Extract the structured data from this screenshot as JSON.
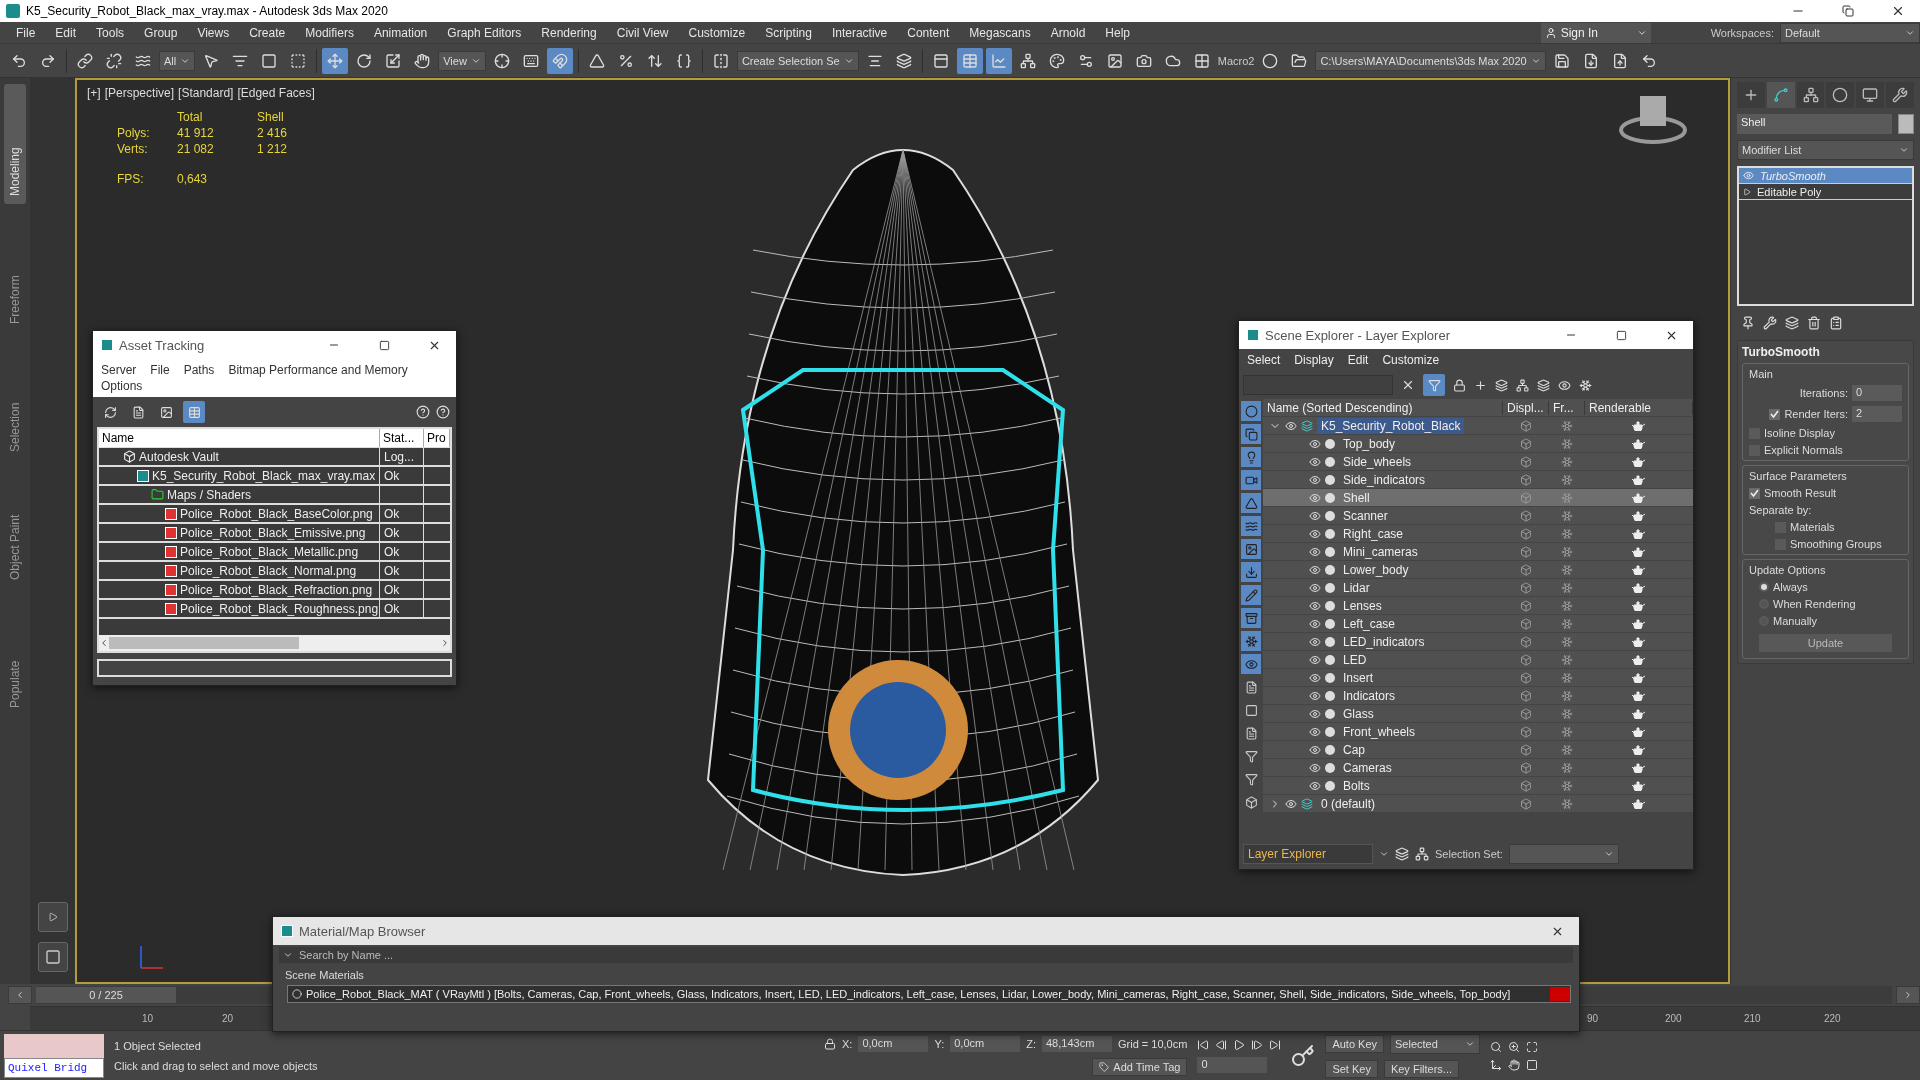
{
  "window": {
    "title": "K5_Security_Robot_Black_max_vray.max - Autodesk 3ds Max 2020"
  },
  "menu": [
    "File",
    "Edit",
    "Tools",
    "Group",
    "Views",
    "Create",
    "Modifiers",
    "Animation",
    "Graph Editors",
    "Rendering",
    "Civil View",
    "Customize",
    "Scripting",
    "Interactive",
    "Content",
    "Megascans",
    "Arnold",
    "Help"
  ],
  "account": {
    "sign_in": "Sign In",
    "workspaces_label": "Workspaces:",
    "workspace": "Default"
  },
  "toolbar": [
    {
      "kind": "icon",
      "selected": false
    },
    {
      "kind": "icon",
      "selected": false
    },
    {
      "kind": "sep"
    },
    {
      "kind": "icon",
      "selected": false
    },
    {
      "kind": "icon",
      "selected": false
    },
    {
      "kind": "icon",
      "selected": false
    },
    {
      "kind": "dropdown",
      "value": "All"
    },
    {
      "kind": "icon",
      "selected": false
    },
    {
      "kind": "icon",
      "selected": false
    },
    {
      "kind": "icon",
      "selected": false
    },
    {
      "kind": "icon",
      "selected": false
    },
    {
      "kind": "sep"
    },
    {
      "kind": "icon",
      "selected": true
    },
    {
      "kind": "icon",
      "selected": false
    },
    {
      "kind": "icon",
      "selected": false
    },
    {
      "kind": "icon",
      "selected": false
    },
    {
      "kind": "dropdown",
      "value": "View"
    },
    {
      "kind": "icon",
      "selected": false
    },
    {
      "kind": "icon",
      "selected": false
    },
    {
      "kind": "icon",
      "selected": true
    },
    {
      "kind": "sep"
    },
    {
      "kind": "icon",
      "selected": false
    },
    {
      "kind": "icon",
      "selected": false
    },
    {
      "kind": "icon",
      "selected": false
    },
    {
      "kind": "icon",
      "selected": false
    },
    {
      "kind": "sep"
    },
    {
      "kind": "icon",
      "selected": false
    },
    {
      "kind": "dropdown",
      "value": "Create Selection Se"
    },
    {
      "kind": "icon",
      "selected": false
    },
    {
      "kind": "icon",
      "selected": false
    },
    {
      "kind": "sep"
    },
    {
      "kind": "icon",
      "selected": false
    },
    {
      "kind": "icon",
      "selected": true
    },
    {
      "kind": "icon",
      "selected": true
    },
    {
      "kind": "icon",
      "selected": false
    },
    {
      "kind": "icon",
      "selected": false
    },
    {
      "kind": "icon",
      "selected": false
    },
    {
      "kind": "icon",
      "selected": false
    },
    {
      "kind": "icon",
      "selected": false
    },
    {
      "kind": "icon",
      "selected": false
    },
    {
      "kind": "icon",
      "selected": false
    },
    {
      "kind": "label",
      "value": "Macro2"
    },
    {
      "kind": "icon",
      "selected": false
    },
    {
      "kind": "icon",
      "selected": false
    },
    {
      "kind": "dropdown",
      "value": "C:\\Users\\MAYA\\Documents\\3ds Max 2020"
    },
    {
      "kind": "icon",
      "selected": false
    },
    {
      "kind": "icon",
      "selected": false
    },
    {
      "kind": "icon",
      "selected": false
    },
    {
      "kind": "icon",
      "selected": false
    }
  ],
  "ribbon_tabs": [
    {
      "label": "Modeling",
      "selected": true
    },
    {
      "label": "Freeform",
      "selected": false
    },
    {
      "label": "Selection",
      "selected": false
    },
    {
      "label": "Object Paint",
      "selected": false
    },
    {
      "label": "Populate",
      "selected": false
    }
  ],
  "viewport": {
    "labels": [
      "[+]",
      "[Perspective]",
      "[Standard]",
      "[Edged Faces]"
    ],
    "stats": {
      "header": [
        "Total",
        "Shell"
      ],
      "rows": [
        {
          "label": "Polys:",
          "total": "41 912",
          "shell": "2 416"
        },
        {
          "label": "Verts:",
          "total": "21 082",
          "shell": "1 212"
        }
      ],
      "fps_label": "FPS:",
      "fps": "0,643"
    }
  },
  "asset_tracking": {
    "title": "Asset Tracking",
    "menu": [
      "Server",
      "File",
      "Paths",
      "Bitmap Performance and Memory",
      "Options"
    ],
    "view_buttons": [
      {
        "selected": false
      },
      {
        "selected": false
      },
      {
        "selected": false
      },
      {
        "selected": true
      }
    ],
    "columns": [
      "Name",
      "Stat...",
      "Pro"
    ],
    "rows": [
      {
        "kind": "vault",
        "name": "Autodesk Vault",
        "status": "Log...",
        "children": [
          {
            "kind": "scene",
            "name": "K5_Security_Robot_Black_max_vray.max",
            "status": "Ok",
            "children": [
              {
                "kind": "folder",
                "name": "Maps / Shaders",
                "children": [
                  {
                    "kind": "bitmap",
                    "name": "Police_Robot_Black_BaseColor.png",
                    "status": "Ok"
                  },
                  {
                    "kind": "bitmap",
                    "name": "Police_Robot_Black_Emissive.png",
                    "status": "Ok"
                  },
                  {
                    "kind": "bitmap",
                    "name": "Police_Robot_Black_Metallic.png",
                    "status": "Ok"
                  },
                  {
                    "kind": "bitmap",
                    "name": "Police_Robot_Black_Normal.png",
                    "status": "Ok"
                  },
                  {
                    "kind": "bitmap",
                    "name": "Police_Robot_Black_Refraction.png",
                    "status": "Ok"
                  },
                  {
                    "kind": "bitmap",
                    "name": "Police_Robot_Black_Roughness.png",
                    "status": "Ok"
                  }
                ]
              }
            ]
          }
        ]
      }
    ]
  },
  "scene_explorer": {
    "title": "Scene Explorer - Layer Explorer",
    "menu": [
      "Select",
      "Display",
      "Edit",
      "Customize"
    ],
    "filter_on": true,
    "filters": [
      {
        "on": true
      },
      {
        "on": true
      },
      {
        "on": true
      },
      {
        "on": true
      },
      {
        "on": true
      },
      {
        "on": true
      },
      {
        "on": true
      },
      {
        "on": true
      },
      {
        "on": true
      },
      {
        "on": true
      },
      {
        "on": true
      },
      {
        "on": true
      },
      {
        "on": false
      },
      {
        "on": false
      },
      {
        "on": false
      },
      {
        "on": false
      },
      {
        "on": false
      },
      {
        "on": false
      }
    ],
    "columns": [
      "Name (Sorted Descending)",
      "Displ...",
      "Fr...",
      "Renderable"
    ],
    "layers": [
      {
        "name": "K5_Security_Robot_Black",
        "active": true,
        "expanded": true,
        "children": [
          {
            "name": "Top_body",
            "selected": false
          },
          {
            "name": "Side_wheels",
            "selected": false
          },
          {
            "name": "Side_indicators",
            "selected": false
          },
          {
            "name": "Shell",
            "selected": true
          },
          {
            "name": "Scanner",
            "selected": false
          },
          {
            "name": "Right_case",
            "selected": false
          },
          {
            "name": "Mini_cameras",
            "selected": false
          },
          {
            "name": "Lower_body",
            "selected": false
          },
          {
            "name": "Lidar",
            "selected": false
          },
          {
            "name": "Lenses",
            "selected": false
          },
          {
            "name": "Left_case",
            "selected": false
          },
          {
            "name": "LED_indicators",
            "selected": false
          },
          {
            "name": "LED",
            "selected": false
          },
          {
            "name": "Insert",
            "selected": false
          },
          {
            "name": "Indicators",
            "selected": false
          },
          {
            "name": "Glass",
            "selected": false
          },
          {
            "name": "Front_wheels",
            "selected": false
          },
          {
            "name": "Cap",
            "selected": false
          },
          {
            "name": "Cameras",
            "selected": false
          },
          {
            "name": "Bolts",
            "selected": false
          }
        ]
      },
      {
        "name": "0 (default)",
        "active": false,
        "expanded": false
      }
    ],
    "mode": "Layer Explorer",
    "selection_set_label": "Selection Set:"
  },
  "command_panel": {
    "tabs": [
      {
        "selected": false
      },
      {
        "selected": true
      },
      {
        "selected": false
      },
      {
        "selected": false
      },
      {
        "selected": false
      },
      {
        "selected": false
      }
    ],
    "object_name": "Shell",
    "modifier_list": "Modifier List",
    "stack": [
      {
        "name": "TurboSmooth",
        "selected": true
      },
      {
        "name": "Editable Poly",
        "selected": false
      }
    ],
    "rollout": {
      "title": "TurboSmooth",
      "main": "Main",
      "iterations_label": "Iterations:",
      "iterations": "0",
      "render_iters_label": "Render Iters:",
      "render_iters_checked": true,
      "render_iters": "2",
      "main_options": [
        {
          "label": "Isoline Display",
          "checked": false
        },
        {
          "label": "Explicit Normals",
          "checked": false
        }
      ],
      "surface": "Surface Parameters",
      "smooth_result": {
        "label": "Smooth Result",
        "checked": true
      },
      "separate_by": "Separate by:",
      "separate_options": [
        {
          "label": "Materials",
          "checked": false
        },
        {
          "label": "Smoothing Groups",
          "checked": false
        }
      ],
      "update_options": "Update Options",
      "update_modes": [
        {
          "label": "Always",
          "selected": true
        },
        {
          "label": "When Rendering",
          "selected": false
        },
        {
          "label": "Manually",
          "selected": false
        }
      ],
      "update_button": "Update"
    }
  },
  "material_browser": {
    "title": "Material/Map Browser",
    "search_placeholder": "Search by Name ...",
    "group": "Scene Materials",
    "material": "Police_Robot_Black_MAT ( VRayMtl ) [Bolts, Cameras, Cap, Front_wheels, Glass, Indicators, Insert, LED, LED_indicators, Left_case, Lenses, Lidar, Lower_body, Mini_cameras, Right_case, Scanner, Shell, Side_indicators, Side_wheels, Top_body]"
  },
  "timeline": {
    "frame": "0 / 225",
    "level": 0,
    "ticks": [
      "10",
      "20",
      "90",
      "200",
      "210",
      "220"
    ]
  },
  "status_bar": {
    "listener": "Quixel Bridg",
    "selection": "1 Object Selected",
    "prompt": "Click and drag to select and move objects",
    "coords": [
      {
        "label": "X:",
        "value": "0,0cm"
      },
      {
        "label": "Y:",
        "value": "0,0cm"
      },
      {
        "label": "Z:",
        "value": "48,143cm"
      }
    ],
    "grid": "Grid = 10,0cm",
    "time_tag": "Add Time Tag",
    "current_frame": "0",
    "auto_key": "Auto Key",
    "key_mode": "Selected",
    "set_key": "Set Key",
    "key_filters": "Key Filters..."
  }
}
